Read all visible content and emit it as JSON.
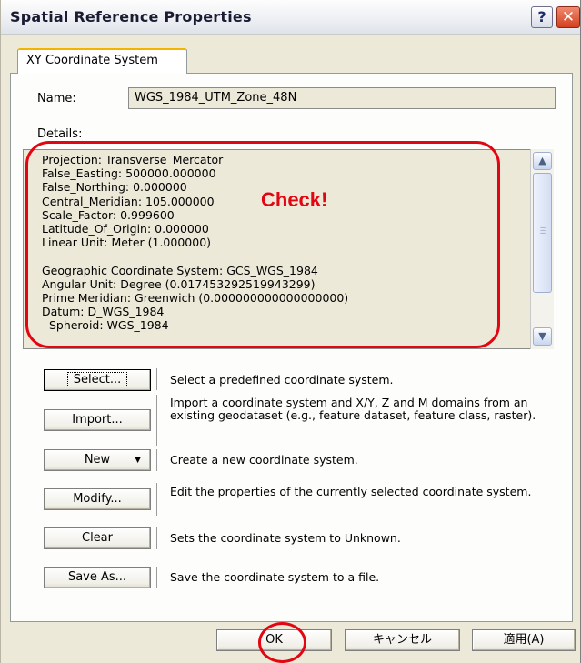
{
  "window": {
    "title": "Spatial Reference Properties",
    "help_glyph": "?",
    "close_glyph": "✕"
  },
  "tab": {
    "label": "XY Coordinate System"
  },
  "name": {
    "label": "Name:",
    "value": "WGS_1984_UTM_Zone_48N"
  },
  "details": {
    "label": "Details:",
    "lines": [
      "Projection: Transverse_Mercator",
      "False_Easting: 500000.000000",
      "False_Northing: 0.000000",
      "Central_Meridian: 105.000000",
      "Scale_Factor: 0.999600",
      "Latitude_Of_Origin: 0.000000",
      "Linear Unit: Meter (1.000000)",
      "",
      "Geographic Coordinate System: GCS_WGS_1984",
      "Angular Unit: Degree (0.017453292519943299)",
      "Prime Meridian: Greenwich (0.000000000000000000)",
      "Datum: D_WGS_1984",
      "  Spheroid: WGS_1984"
    ],
    "scroll_up_glyph": "▲",
    "scroll_down_glyph": "▼"
  },
  "annotation": {
    "check_text": "Check!"
  },
  "actions": [
    {
      "button": "Select...",
      "description": "Select a predefined coordinate system."
    },
    {
      "button": "Import...",
      "description": "Import a coordinate system and X/Y, Z and M domains from an existing geodataset (e.g., feature dataset, feature class, raster)."
    },
    {
      "button": "New",
      "dropdown_glyph": "▼",
      "description": "Create a new coordinate system."
    },
    {
      "button": "Modify...",
      "description": "Edit the properties of the currently selected coordinate system."
    },
    {
      "button": "Clear",
      "description": "Sets the coordinate system to Unknown."
    },
    {
      "button": "Save As...",
      "description": "Save the coordinate system to a file."
    }
  ],
  "footer": {
    "ok": "OK",
    "cancel": "キャンセル",
    "apply": "適用(A)"
  },
  "colors": {
    "annotation_red": "#e20613",
    "dialog_face": "#ece9d8",
    "tab_highlight": "#f2b400"
  }
}
